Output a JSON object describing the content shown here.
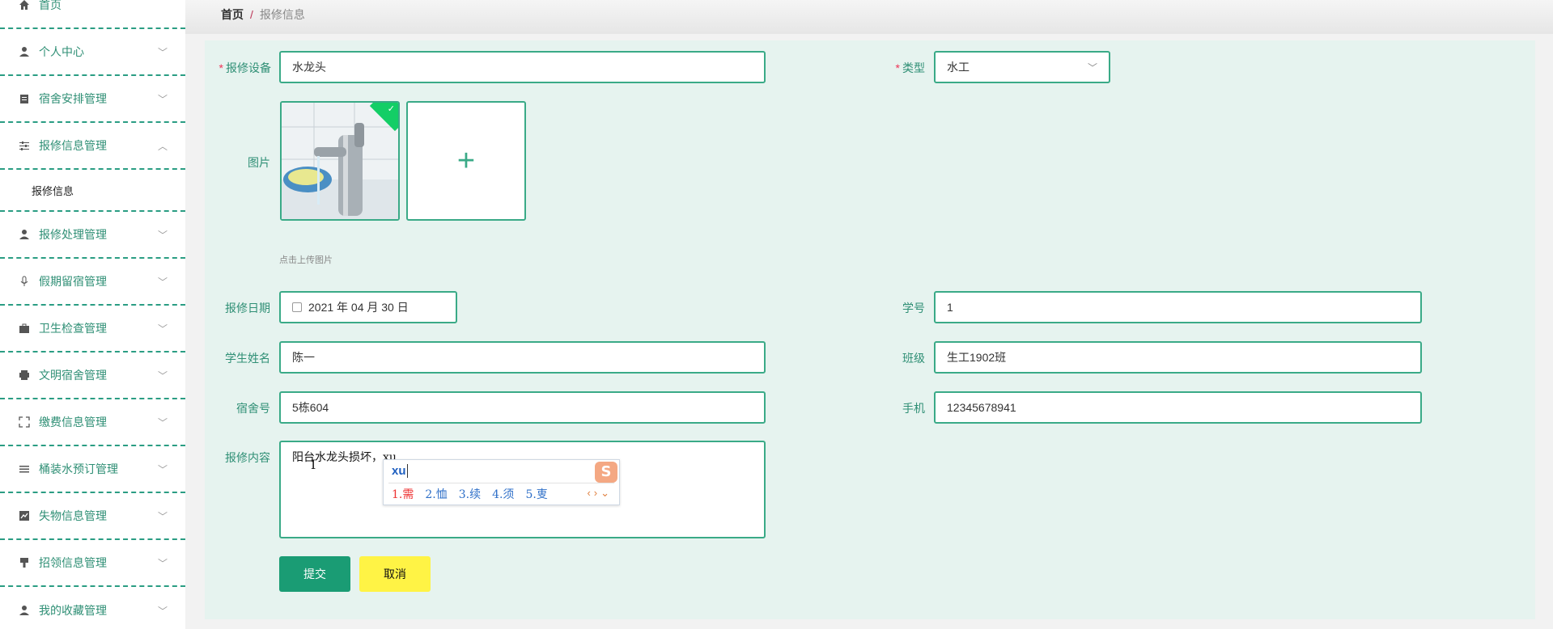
{
  "breadcrumb": {
    "home": "首页",
    "separator": "/",
    "current": "报修信息"
  },
  "sidebar": {
    "items": [
      {
        "label": "首页",
        "icon": "home-icon"
      },
      {
        "label": "个人中心",
        "icon": "user-icon"
      },
      {
        "label": "宿舍安排管理",
        "icon": "clipboard-icon"
      },
      {
        "label": "报修信息管理",
        "icon": "sliders-icon",
        "expanded": true
      },
      {
        "label": "报修信息",
        "sub": true
      },
      {
        "label": "报修处理管理",
        "icon": "user-icon"
      },
      {
        "label": "假期留宿管理",
        "icon": "mic-icon"
      },
      {
        "label": "卫生检查管理",
        "icon": "briefcase-icon"
      },
      {
        "label": "文明宿舍管理",
        "icon": "printer-icon"
      },
      {
        "label": "缴费信息管理",
        "icon": "fullscreen-icon"
      },
      {
        "label": "桶装水预订管理",
        "icon": "list-icon"
      },
      {
        "label": "失物信息管理",
        "icon": "chart-icon"
      },
      {
        "label": "招领信息管理",
        "icon": "brush-icon"
      },
      {
        "label": "我的收藏管理",
        "icon": "user-icon"
      }
    ]
  },
  "form": {
    "device": {
      "label": "报修设备",
      "value": "水龙头",
      "required": true
    },
    "type": {
      "label": "类型",
      "value": "水工",
      "required": true
    },
    "image": {
      "label": "图片",
      "hint": "点击上传图片"
    },
    "date": {
      "label": "报修日期",
      "value": "2021 年 04 月 30 日"
    },
    "student_id": {
      "label": "学号",
      "value": "1"
    },
    "student_name": {
      "label": "学生姓名",
      "value": "陈一"
    },
    "class": {
      "label": "班级",
      "value": "生工1902班"
    },
    "dorm": {
      "label": "宿舍号",
      "value": "5栋604"
    },
    "phone": {
      "label": "手机",
      "value": "12345678941"
    },
    "content": {
      "label": "报修内容",
      "value": "阳台水龙头损坏，xu"
    }
  },
  "ime": {
    "pinyin": "xu",
    "candidates": [
      "1.需",
      "2.恤",
      "3.续",
      "4.须",
      "5.叓"
    ],
    "logo": "S"
  },
  "buttons": {
    "submit": "提交",
    "cancel": "取消"
  },
  "colors": {
    "accent": "#2f8f75",
    "border": "#3aaa87",
    "submit_bg": "#1a9c74",
    "cancel_bg": "#fff345"
  }
}
